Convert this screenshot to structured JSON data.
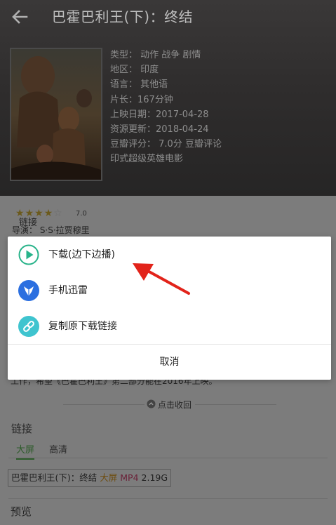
{
  "header": {
    "title": "巴霍巴利王(下)：终结",
    "info": [
      "类型：  动作 战争 剧情",
      "地区：  印度",
      "语言：  其他语",
      "片长：167分钟",
      "上映日期：2017-04-28",
      "资源更新：2018-04-24",
      "豆瓣评分：  7.0分  豆瓣评论",
      "印式超级英雄电影"
    ]
  },
  "body": {
    "rating_value": "7.0",
    "director": "导演：  S·S·拉贾穆里",
    "ghost_link": "链接",
    "desc_tail": "工作，希望《巴霍巴利王》第二部分能在2016年上映。",
    "collapse_label": "点击收回",
    "links_title": "链接",
    "tabs": [
      "大屏",
      "高清"
    ],
    "file": {
      "name": "巴霍巴利王(下)：终结",
      "quality": "大屏",
      "format": "MP4",
      "size": "2.19G"
    },
    "preview_title": "预览"
  },
  "dialog": {
    "options": [
      {
        "label": "下载(边下边播)",
        "icon": "play-circle-icon"
      },
      {
        "label": "手机迅雷",
        "icon": "xunlei-bird-icon"
      },
      {
        "label": "复制原下载链接",
        "icon": "link-icon"
      }
    ],
    "cancel_label": "取消"
  },
  "colors": {
    "accent_green": "#28b38a",
    "xunlei_blue": "#2b6fe0",
    "link_teal": "#3fc4cf",
    "annotation_red": "#e2231a"
  }
}
